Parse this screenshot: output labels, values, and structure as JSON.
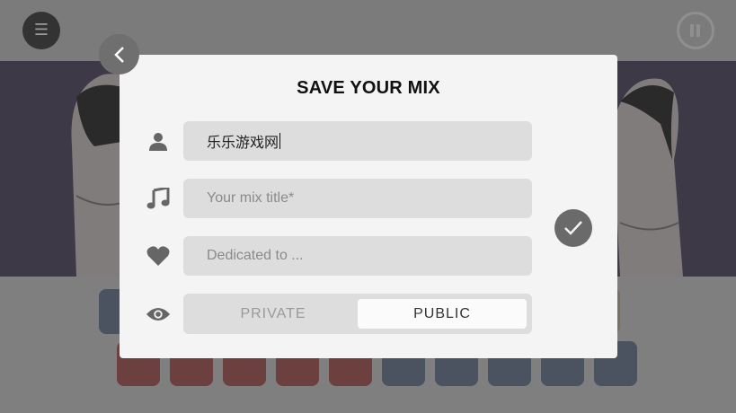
{
  "header": {
    "menu_icon": "menu-icon",
    "pause_icon": "pause-icon"
  },
  "dialog": {
    "title": "SAVE YOUR MIX",
    "author": {
      "icon": "user-icon",
      "value": "乐乐游戏网"
    },
    "mix_title": {
      "icon": "music-note-icon",
      "placeholder": "Your mix title*"
    },
    "dedicated": {
      "icon": "heart-icon",
      "placeholder": "Dedicated to ..."
    },
    "visibility": {
      "icon": "eye-icon",
      "options": [
        "PRIVATE",
        "PUBLIC"
      ],
      "selected": "PUBLIC"
    },
    "confirm_icon": "check-icon",
    "back_icon": "chevron-left-icon"
  },
  "colors": {
    "modal_bg": "#f4f4f4",
    "field_bg": "#dddddd",
    "stage_bg": "#3d3946",
    "overlay": "#7f7f7f"
  }
}
